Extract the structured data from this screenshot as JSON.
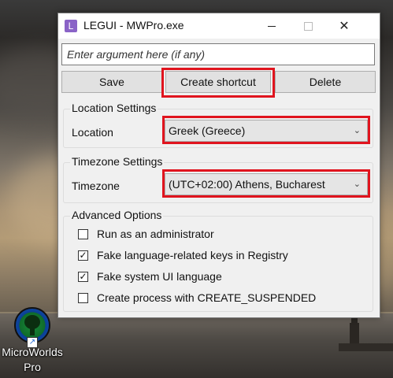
{
  "window": {
    "title": "LEGUI - MWPro.exe",
    "app_icon_letter": "L",
    "controls": {
      "minimize": "—",
      "maximize": "",
      "close": "✕"
    }
  },
  "argument": {
    "placeholder": "Enter argument here (if any)",
    "value": ""
  },
  "toolbar": {
    "save_label": "Save",
    "create_shortcut_label": "Create shortcut",
    "delete_label": "Delete"
  },
  "location_settings": {
    "title": "Location Settings",
    "label": "Location",
    "selected": "Greek (Greece)"
  },
  "timezone_settings": {
    "title": "Timezone Settings",
    "label": "Timezone",
    "selected": "(UTC+02:00) Athens, Bucharest"
  },
  "advanced_options": {
    "title": "Advanced Options",
    "items": [
      {
        "label": "Run as an administrator",
        "checked": false,
        "mark": ""
      },
      {
        "label": "Fake language-related keys in Registry",
        "checked": true,
        "mark": "✓"
      },
      {
        "label": "Fake system UI language",
        "checked": true,
        "mark": "✓"
      },
      {
        "label": "Create process with CREATE_SUSPENDED",
        "checked": false,
        "mark": ""
      }
    ]
  },
  "desktop": {
    "icon_label_line1": "MicroWorlds",
    "icon_label_line2": "Pro",
    "shortcut_arrow": "↗"
  },
  "colors": {
    "highlight": "#e0141e",
    "app_icon": "#8a63c7"
  }
}
